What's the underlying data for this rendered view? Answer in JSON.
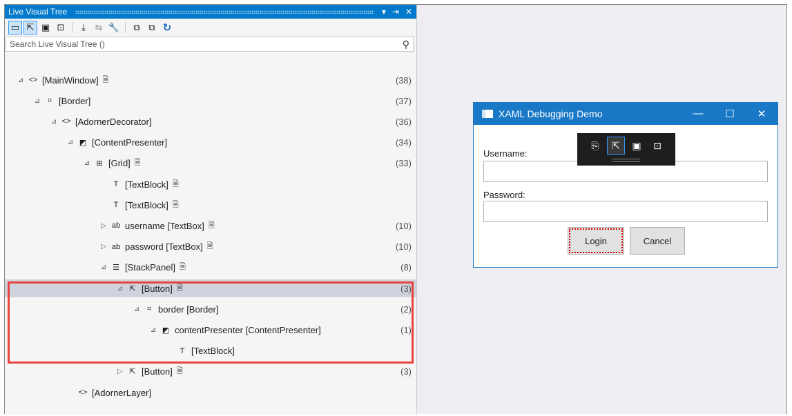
{
  "panel": {
    "title": "Live Visual Tree",
    "title_icons": [
      "chevron-down-icon",
      "pin-icon",
      "close-icon"
    ],
    "title_glyphs": [
      "▾",
      "⇥",
      "✕"
    ],
    "toolbar": [
      {
        "name": "select-element-icon",
        "glyph": "▭",
        "active": true
      },
      {
        "name": "select-in-running-app-icon",
        "glyph": "⇱",
        "active": true
      },
      {
        "name": "display-layout-adorners-icon",
        "glyph": "▣",
        "active": false
      },
      {
        "name": "preview-selection-icon",
        "glyph": "⊡",
        "active": false
      },
      {
        "sep": true
      },
      {
        "name": "show-just-my-xaml-icon",
        "glyph": "⤓",
        "active": false
      },
      {
        "name": "track-focus-icon",
        "glyph": "⇆",
        "active": false,
        "grey": true
      },
      {
        "name": "properties-wrench-icon",
        "glyph": "🔧",
        "active": false
      },
      {
        "sep": true
      },
      {
        "name": "expand-all-icon",
        "glyph": "⧉",
        "active": false
      },
      {
        "name": "collapse-all-icon",
        "glyph": "⧉",
        "active": false
      },
      {
        "name": "refresh-icon",
        "glyph": "↻",
        "active": false,
        "blue": true
      }
    ],
    "search_placeholder": "Search Live Visual Tree ()",
    "search_icon": "magnifier-icon"
  },
  "tree": [
    {
      "label": "[MainWindow]",
      "icon": "<>",
      "expander": "⊿",
      "doc": true,
      "count": "(38)",
      "indent": 0
    },
    {
      "label": "[Border]",
      "icon": "⌗",
      "expander": "⊿",
      "doc": false,
      "count": "(37)",
      "indent": 1
    },
    {
      "label": "[AdornerDecorator]",
      "icon": "<>",
      "expander": "⊿",
      "doc": false,
      "count": "(36)",
      "indent": 2
    },
    {
      "label": "[ContentPresenter]",
      "icon": "◩",
      "expander": "⊿",
      "doc": false,
      "count": "(34)",
      "indent": 3
    },
    {
      "label": "[Grid]",
      "icon": "⊞",
      "expander": "⊿",
      "doc": true,
      "count": "(33)",
      "indent": 4
    },
    {
      "label": "[TextBlock]",
      "icon": "T",
      "expander": "",
      "doc": true,
      "count": "",
      "indent": 5
    },
    {
      "label": "[TextBlock]",
      "icon": "T",
      "expander": "",
      "doc": true,
      "count": "",
      "indent": 5
    },
    {
      "label": "username [TextBox]",
      "icon": "ab",
      "expander": "▷",
      "doc": true,
      "count": "(10)",
      "indent": 5
    },
    {
      "label": "password [TextBox]",
      "icon": "ab",
      "expander": "▷",
      "doc": true,
      "count": "(10)",
      "indent": 5
    },
    {
      "label": "[StackPanel]",
      "icon": "☰",
      "expander": "⊿",
      "doc": true,
      "count": "(8)",
      "indent": 5
    },
    {
      "label": "[Button]",
      "icon": "⇱",
      "expander": "⊿",
      "doc": true,
      "count": "(3)",
      "indent": 6,
      "selected": true
    },
    {
      "label": "border [Border]",
      "icon": "⌗",
      "expander": "⊿",
      "doc": false,
      "count": "(2)",
      "indent": 7
    },
    {
      "label": "contentPresenter [ContentPresenter]",
      "icon": "◩",
      "expander": "⊿",
      "doc": false,
      "count": "(1)",
      "indent": 8
    },
    {
      "label": "[TextBlock]",
      "icon": "T",
      "expander": "",
      "doc": false,
      "count": "",
      "indent": 9
    },
    {
      "label": "[Button]",
      "icon": "⇱",
      "expander": "▷",
      "doc": true,
      "count": "(3)",
      "indent": 6
    },
    {
      "label": "[AdornerLayer]",
      "icon": "<>",
      "expander": "",
      "doc": false,
      "count": "",
      "indent": 3
    }
  ],
  "app_window": {
    "title": "XAML Debugging Demo",
    "controls": [
      "minimize-icon",
      "maximize-icon",
      "close-icon"
    ],
    "control_glyphs": [
      "—",
      "☐",
      "✕"
    ],
    "username_label": "Username:",
    "username_value": "",
    "password_label": "Password:",
    "password_value": "",
    "login_label": "Login",
    "cancel_label": "Cancel",
    "adorner_tools": [
      {
        "name": "go-to-live-visual-tree-icon",
        "glyph": "⎘",
        "on": false
      },
      {
        "name": "select-element-icon",
        "glyph": "⇱",
        "on": true
      },
      {
        "name": "display-layout-adorners-icon",
        "glyph": "▣",
        "on": false
      },
      {
        "name": "track-focused-element-icon",
        "glyph": "⊡",
        "on": false
      }
    ]
  },
  "colors": {
    "accent": "#007acc",
    "window_title": "#1a79c6",
    "highlight_border": "#e8423f",
    "selected_row": "#cfd3de",
    "focus_dots": "#d40000"
  }
}
